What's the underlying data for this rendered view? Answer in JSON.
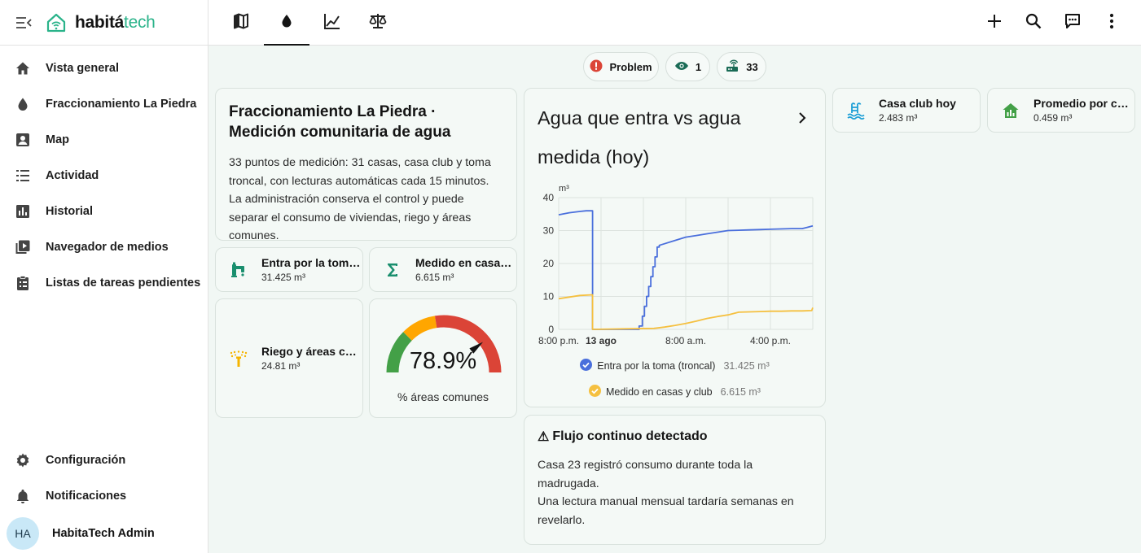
{
  "brand": {
    "name_main": "habitá",
    "name_accent": "tech"
  },
  "sidebar": {
    "items": [
      {
        "label": "Vista general"
      },
      {
        "label": "Fraccionamiento La Piedra"
      },
      {
        "label": "Map"
      },
      {
        "label": "Actividad"
      },
      {
        "label": "Historial"
      },
      {
        "label": "Navegador de medios"
      },
      {
        "label": "Listas de tareas pendientes"
      }
    ],
    "settings": "Configuración",
    "notifications": "Notificaciones",
    "user": {
      "initials": "HA",
      "name": "HabitaTech Admin"
    }
  },
  "badges": [
    {
      "label": "Problem"
    },
    {
      "label": "1"
    },
    {
      "label": "33"
    }
  ],
  "title_card": {
    "title": "Fraccionamiento La Piedra · Medición comunitaria de agua",
    "body": "33 puntos de medición: 31 casas, casa club y toma troncal, con lecturas automáticas cada 15 minutos. La administración conserva el control y puede separar el consumo de viviendas, riego y áreas comunes."
  },
  "tiles": {
    "toma": {
      "name": "Entra por la toma (troncal)",
      "value": "31.425 m³"
    },
    "medido": {
      "name": "Medido en casas y club",
      "value": "6.615 m³"
    },
    "riego": {
      "name": "Riego y áreas comunes",
      "value": "24.81 m³"
    },
    "club": {
      "name": "Casa club hoy",
      "value": "2.483 m³"
    },
    "promedio": {
      "name": "Promedio por casa",
      "value": "0.459 m³"
    }
  },
  "gauge": {
    "value_text": "78.9%",
    "value": 78.9,
    "label": "% áreas comunes"
  },
  "colors": {
    "accent": "#2ab38a",
    "blue": "#4a6fdc",
    "yellow": "#f5c040",
    "gauge_green": "#43a047",
    "gauge_yellow": "#ffa600",
    "gauge_red": "#db4437"
  },
  "chart_data": {
    "type": "line",
    "title": "Agua que entra vs agua medida (hoy)",
    "unit": "m³",
    "ylim": [
      0,
      40
    ],
    "yticks": [
      "0",
      "10",
      "20",
      "30",
      "40"
    ],
    "xticks": [
      "8:00 p.m.",
      "13 ago",
      "8:00 a.m.",
      "4:00 p.m."
    ],
    "xlim": [
      0,
      24
    ],
    "grid": true,
    "legend": "bottom",
    "series": [
      {
        "name": "Entra por la toma (troncal)",
        "color": "#4a6fdc",
        "value_text": "31.425 m³",
        "x": [
          0,
          1,
          2,
          2.6,
          3.2,
          3.2,
          5,
          7.6,
          7.6,
          7.9,
          7.9,
          8.1,
          8.1,
          8.3,
          8.3,
          8.5,
          8.5,
          8.7,
          8.7,
          8.9,
          8.9,
          9.1,
          9.1,
          9.3,
          9.3,
          9.5,
          9.5,
          10,
          11,
          12,
          13,
          14,
          15,
          16,
          17,
          18,
          19,
          20,
          21,
          22,
          23,
          23.5,
          24
        ],
        "y": [
          34.8,
          35.4,
          35.8,
          36,
          36,
          0,
          0,
          0,
          1,
          1,
          4,
          4,
          7,
          7,
          10,
          10,
          13,
          13,
          16,
          16,
          19,
          19,
          22,
          22,
          25,
          25,
          25.5,
          26,
          27,
          28,
          28.5,
          29,
          29.5,
          30,
          30.1,
          30.2,
          30.3,
          30.4,
          30.5,
          30.6,
          30.6,
          31,
          31.4
        ]
      },
      {
        "name": "Medido en casas y club",
        "color": "#f5c040",
        "value_text": "6.615 m³",
        "x": [
          0,
          1,
          2,
          3.2,
          3.2,
          5,
          7,
          9,
          10,
          11,
          12,
          13,
          14,
          15,
          16,
          17,
          18,
          19,
          20,
          21,
          22,
          23,
          23.9,
          24
        ],
        "y": [
          9.3,
          9.8,
          10.3,
          10.5,
          0,
          0.1,
          0.2,
          0.3,
          0.7,
          1.2,
          1.8,
          2.5,
          3.3,
          3.9,
          4.4,
          5.2,
          5.3,
          5.4,
          5.5,
          5.5,
          5.6,
          5.6,
          5.7,
          6.6
        ]
      }
    ]
  },
  "alert": {
    "icon": "⚠",
    "title": "Flujo continuo detectado",
    "line1": "Casa 23 registró consumo durante toda la madrugada.",
    "line2": "Una lectura manual mensual tardaría semanas en revelarlo."
  }
}
